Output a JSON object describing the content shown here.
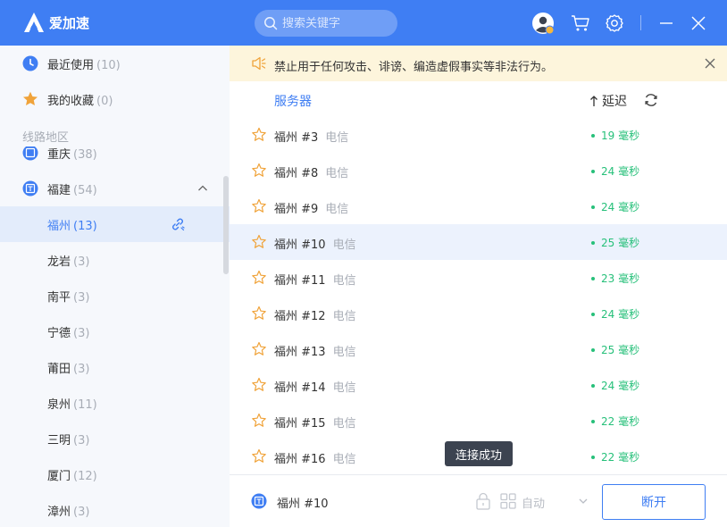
{
  "app": {
    "logo_text": "爱加速"
  },
  "search": {
    "placeholder": "搜索关键字"
  },
  "colors": {
    "brand": "#3f7ef3",
    "latency_good": "#27c07a",
    "star": "#f0a33a",
    "notice_bg": "#fdf5dc"
  },
  "sidebar": {
    "recent": {
      "label": "最近使用",
      "count": "(10)"
    },
    "favorites": {
      "label": "我的收藏",
      "count": "(0)"
    },
    "section_title": "线路地区",
    "partial": {
      "label": "重庆",
      "count": "(38)",
      "badge": "渝"
    },
    "province": {
      "label": "福建",
      "count": "(54)",
      "badge": "闽"
    },
    "cities": [
      {
        "label": "福州",
        "count": "(13)"
      },
      {
        "label": "龙岩",
        "count": "(3)"
      },
      {
        "label": "南平",
        "count": "(3)"
      },
      {
        "label": "宁德",
        "count": "(3)"
      },
      {
        "label": "莆田",
        "count": "(3)"
      },
      {
        "label": "泉州",
        "count": "(11)"
      },
      {
        "label": "三明",
        "count": "(3)"
      },
      {
        "label": "厦门",
        "count": "(12)"
      },
      {
        "label": "漳州",
        "count": "(3)"
      }
    ]
  },
  "notice": {
    "text": "禁止用于任何攻击、诽谤、编造虚假事实等非法行为。"
  },
  "list": {
    "header_server": "服务器",
    "header_latency": "延迟",
    "rows": [
      {
        "name": "福州 #3",
        "isp": "电信",
        "latency": "19 毫秒"
      },
      {
        "name": "福州 #8",
        "isp": "电信",
        "latency": "24 毫秒"
      },
      {
        "name": "福州 #9",
        "isp": "电信",
        "latency": "24 毫秒"
      },
      {
        "name": "福州 #10",
        "isp": "电信",
        "latency": "25 毫秒"
      },
      {
        "name": "福州 #11",
        "isp": "电信",
        "latency": "23 毫秒"
      },
      {
        "name": "福州 #12",
        "isp": "电信",
        "latency": "24 毫秒"
      },
      {
        "name": "福州 #13",
        "isp": "电信",
        "latency": "25 毫秒"
      },
      {
        "name": "福州 #14",
        "isp": "电信",
        "latency": "24 毫秒"
      },
      {
        "name": "福州 #15",
        "isp": "电信",
        "latency": "22 毫秒"
      },
      {
        "name": "福州 #16",
        "isp": "电信",
        "latency": "22 毫秒"
      }
    ]
  },
  "tooltip": {
    "text": "连接成功"
  },
  "footer": {
    "badge": "闽",
    "current_server": "福州 #10",
    "mode": "自动",
    "disconnect_label": "断开"
  }
}
